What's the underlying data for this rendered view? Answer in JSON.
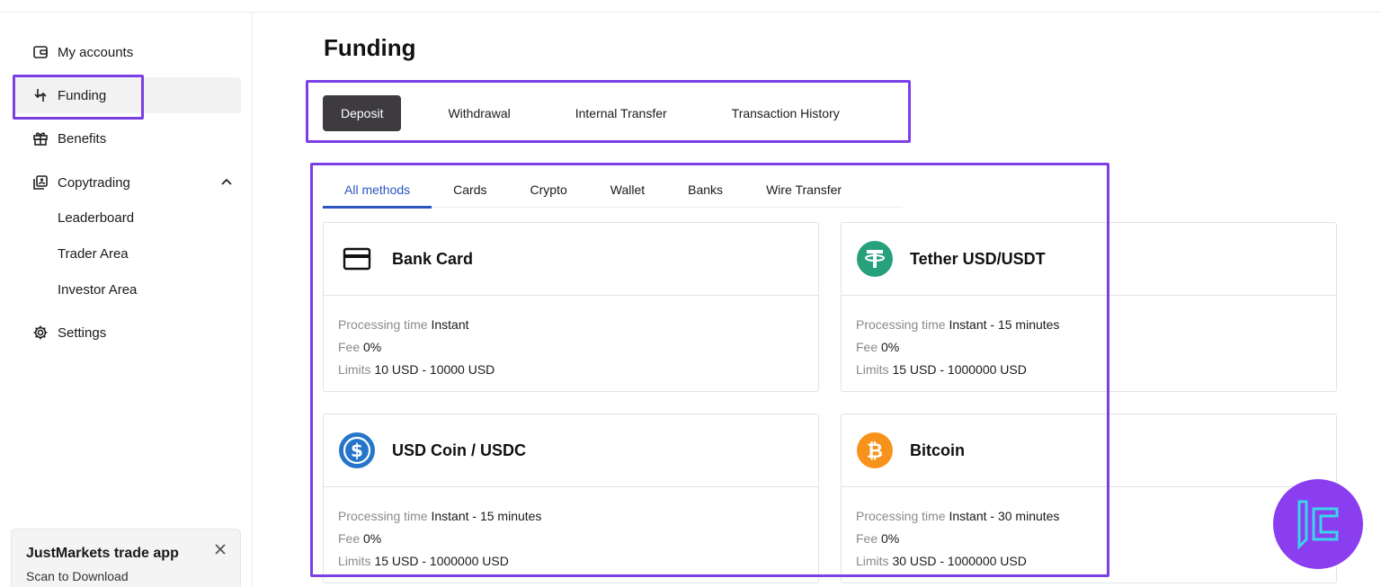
{
  "sidebar": {
    "items": [
      {
        "label": "My accounts",
        "icon": "wallet-icon"
      },
      {
        "label": "Funding",
        "icon": "funding-arrows-icon"
      },
      {
        "label": "Benefits",
        "icon": "gift-icon"
      },
      {
        "label": "Copytrading",
        "icon": "copytrading-icon"
      },
      {
        "label": "Settings",
        "icon": "gear-icon"
      }
    ],
    "copytrading_sub": [
      "Leaderboard",
      "Trader Area",
      "Investor Area"
    ]
  },
  "app_banner": {
    "title": "JustMarkets trade app",
    "subtitle": "Scan to Download"
  },
  "main": {
    "title": "Funding",
    "tabs": [
      "Deposit",
      "Withdrawal",
      "Internal Transfer",
      "Transaction History"
    ],
    "method_tabs": [
      "All methods",
      "Cards",
      "Crypto",
      "Wallet",
      "Banks",
      "Wire Transfer"
    ],
    "labels": {
      "processing": "Processing time",
      "fee": "Fee",
      "limits": "Limits"
    },
    "methods": [
      {
        "name": "Bank Card",
        "icon": "card-icon",
        "processing": "Instant",
        "fee": "0%",
        "limits": "10 USD - 10000 USD"
      },
      {
        "name": "Tether USD/USDT",
        "icon": "tether-icon",
        "processing": "Instant - 15 minutes",
        "fee": "0%",
        "limits": "15 USD - 1000000 USD"
      },
      {
        "name": "USD Coin / USDC",
        "icon": "usdc-icon",
        "processing": "Instant - 15 minutes",
        "fee": "0%",
        "limits": "15 USD - 1000000 USD"
      },
      {
        "name": "Bitcoin",
        "icon": "bitcoin-icon",
        "processing": "Instant - 30 minutes",
        "fee": "0%",
        "limits": "30 USD - 1000000 USD"
      }
    ]
  },
  "colors": {
    "accent": "#2b55c2",
    "highlight": "#7b3fe4",
    "active_tab": "#3d3b40",
    "tether": "#26a17b",
    "usdc": "#2775ca",
    "bitcoin": "#f7931a"
  }
}
